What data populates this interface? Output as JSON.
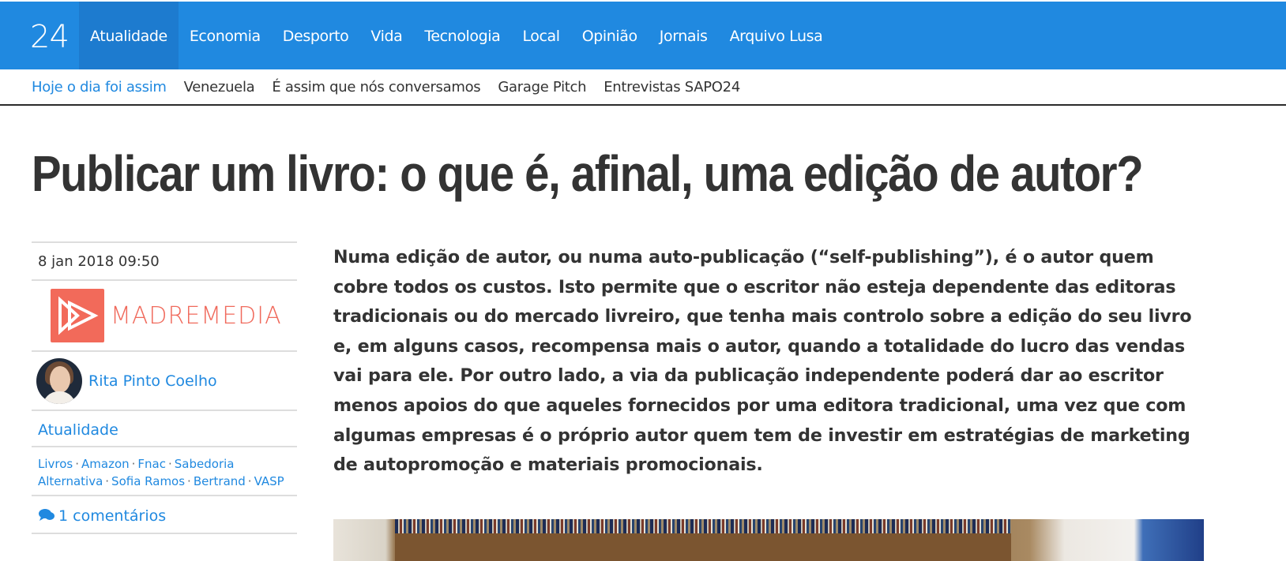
{
  "site": {
    "brand": "24",
    "top_nav": [
      "Atualidade",
      "Economia",
      "Desporto",
      "Vida",
      "Tecnologia",
      "Local",
      "Opinião",
      "Jornais",
      "Arquivo Lusa"
    ],
    "sub_nav": [
      "Hoje o dia foi assim",
      "Venezuela",
      "É assim que nós conversamos",
      "Garage Pitch",
      "Entrevistas SAPO24"
    ],
    "accent_color": "#2089e0"
  },
  "article": {
    "title": "Publicar um livro: o que é, afinal, uma edição de autor?",
    "date": "8 jan 2018 09:50",
    "publisher_logo_text": "MADREMEDIA",
    "author": "Rita Pinto Coelho",
    "section": "Atualidade",
    "tags": [
      "Livros",
      "Amazon",
      "Fnac",
      "Sabedoria Alternativa",
      "Sofia Ramos",
      "Bertrand",
      "VASP"
    ],
    "comments": "1 comentários",
    "lead": "Numa edição de autor, ou numa auto-publicação (“self-publishing”), é o autor quem cobre todos os custos. Isto permite que o escritor não esteja dependente das editoras tradicionais ou do mercado livreiro, que tenha mais controlo sobre a edição  do seu livro e, em alguns casos, recompensa mais o autor, quando a totalidade do lucro das vendas vai para ele. Por outro lado, a via da publicação independente poderá dar ao escritor menos apoios do que aqueles fornecidos por uma editora tradicional, uma vez que com algumas empresas é o próprio autor quem tem de investir em estratégias de marketing de autopromoção e materiais promocionais."
  }
}
